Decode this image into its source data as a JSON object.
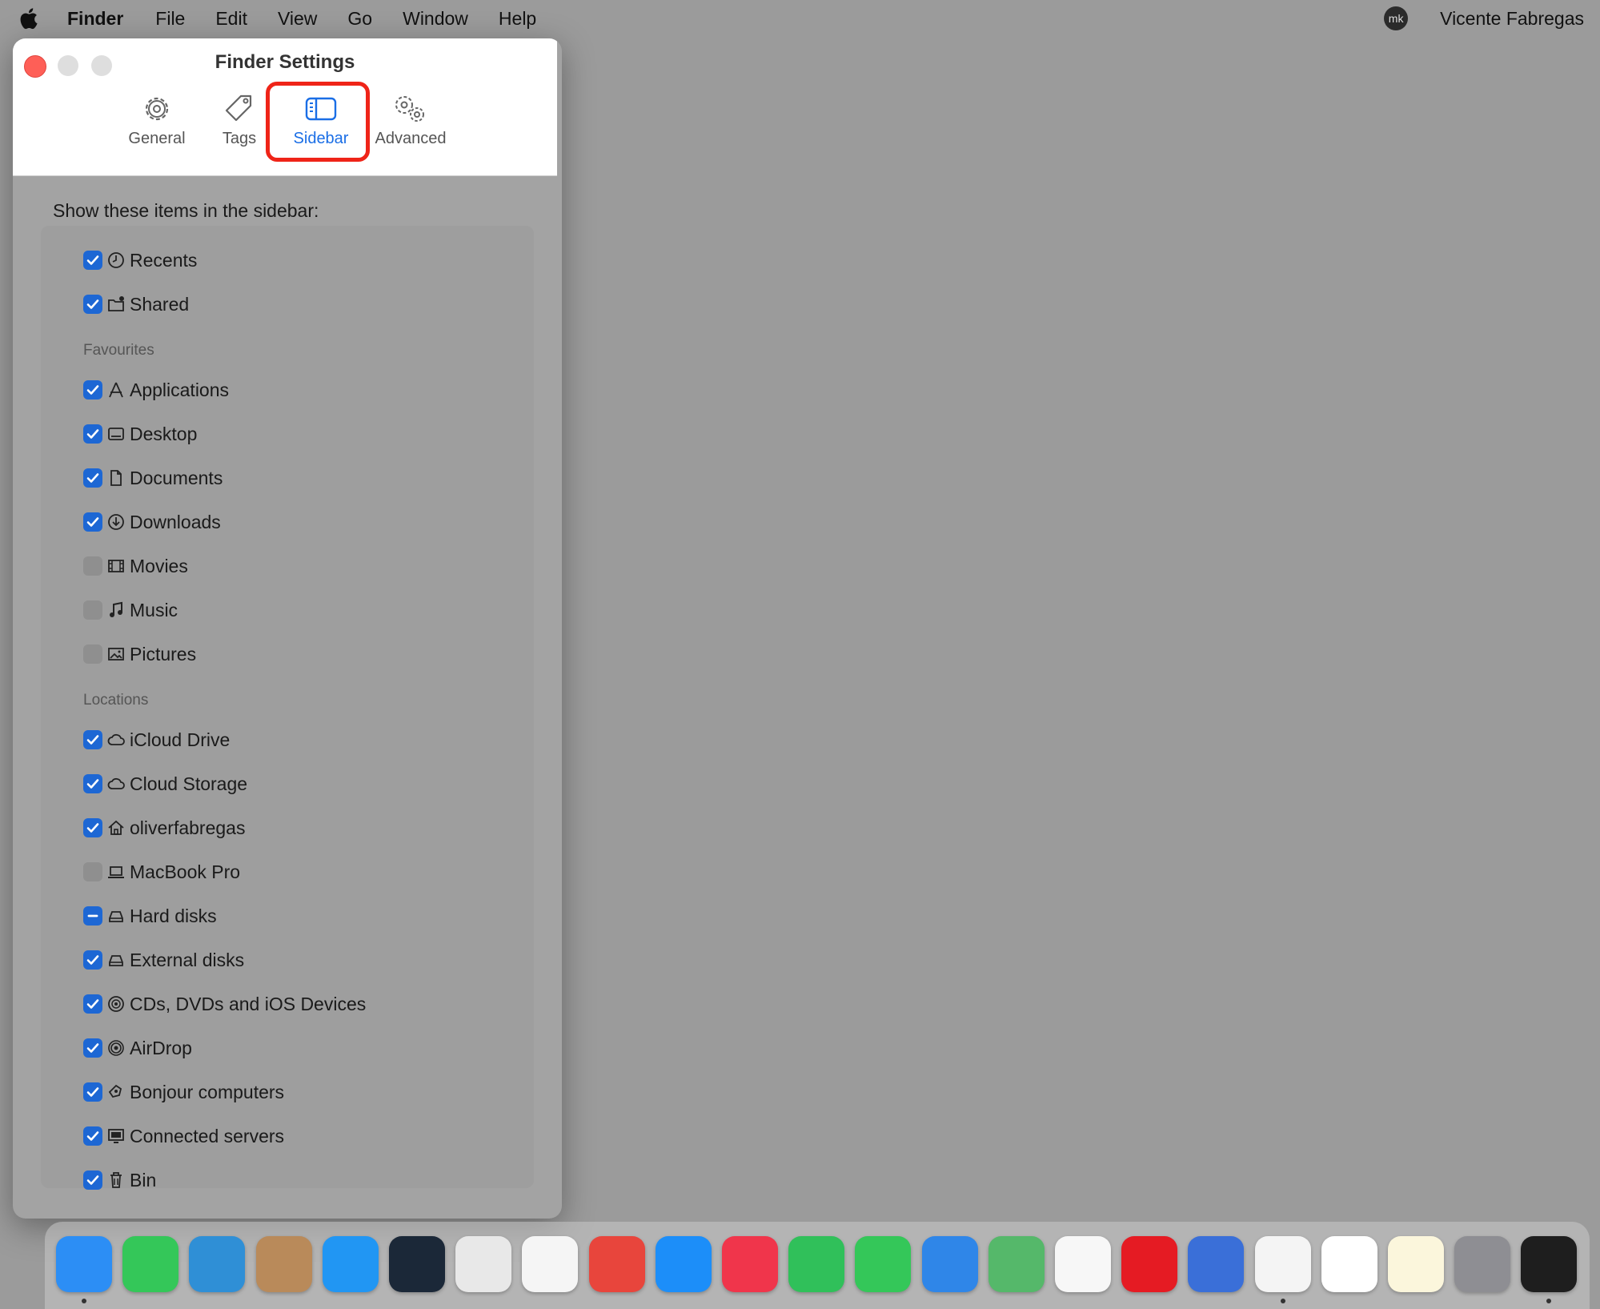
{
  "menubar": {
    "app": "Finder",
    "items": [
      "File",
      "Edit",
      "View",
      "Go",
      "Window",
      "Help"
    ],
    "status_icon": "mk",
    "user": "Vicente Fabregas"
  },
  "window": {
    "title": "Finder Settings",
    "tabs": [
      {
        "label": "General",
        "icon": "gear-icon"
      },
      {
        "label": "Tags",
        "icon": "tag-icon"
      },
      {
        "label": "Sidebar",
        "icon": "sidebar-icon",
        "active": true
      },
      {
        "label": "Advanced",
        "icon": "gears-icon"
      }
    ],
    "heading": "Show these items in the sidebar:",
    "top_items": [
      {
        "label": "Recents",
        "checked": "on",
        "icon": "clock-icon"
      },
      {
        "label": "Shared",
        "checked": "on",
        "icon": "shared-folder-icon"
      }
    ],
    "favourites_label": "Favourites",
    "favourites": [
      {
        "label": "Applications",
        "checked": "on",
        "icon": "applications-icon"
      },
      {
        "label": "Desktop",
        "checked": "on",
        "icon": "desktop-icon"
      },
      {
        "label": "Documents",
        "checked": "on",
        "icon": "document-icon"
      },
      {
        "label": "Downloads",
        "checked": "on",
        "icon": "download-icon"
      },
      {
        "label": "Movies",
        "checked": "off",
        "icon": "film-icon"
      },
      {
        "label": "Music",
        "checked": "off",
        "icon": "music-note-icon"
      },
      {
        "label": "Pictures",
        "checked": "off",
        "icon": "photo-icon"
      }
    ],
    "locations_label": "Locations",
    "locations": [
      {
        "label": "iCloud Drive",
        "checked": "on",
        "icon": "cloud-icon"
      },
      {
        "label": "Cloud Storage",
        "checked": "on",
        "icon": "cloud-icon"
      },
      {
        "label": "oliverfabregas",
        "checked": "on",
        "icon": "home-icon"
      },
      {
        "label": "MacBook Pro",
        "checked": "off",
        "icon": "laptop-icon"
      },
      {
        "label": "Hard disks",
        "checked": "mixed",
        "icon": "hard-disk-icon"
      },
      {
        "label": "External disks",
        "checked": "on",
        "icon": "external-disk-icon"
      },
      {
        "label": "CDs, DVDs and iOS Devices",
        "checked": "on",
        "icon": "disc-icon"
      },
      {
        "label": "AirDrop",
        "checked": "on",
        "icon": "airdrop-icon"
      },
      {
        "label": "Bonjour computers",
        "checked": "on",
        "icon": "bonjour-icon"
      },
      {
        "label": "Connected servers",
        "checked": "on",
        "icon": "server-icon"
      },
      {
        "label": "Bin",
        "checked": "on",
        "icon": "trash-icon"
      }
    ]
  },
  "dock": [
    {
      "name": "finder",
      "color": "#2c8ef5",
      "running": true
    },
    {
      "name": "facetime",
      "color": "#34c759",
      "running": false
    },
    {
      "name": "mk",
      "color": "#2f8fd6",
      "running": false
    },
    {
      "name": "contacts",
      "color": "#b98a5a",
      "running": false
    },
    {
      "name": "safari",
      "color": "#2196f3",
      "running": false
    },
    {
      "name": "steam",
      "color": "#1b2838",
      "running": false
    },
    {
      "name": "launchpad",
      "color": "#e8e8e8",
      "running": false
    },
    {
      "name": "reminders",
      "color": "#f5f5f5",
      "running": false
    },
    {
      "name": "rocket",
      "color": "#e8453c",
      "running": false
    },
    {
      "name": "app-store",
      "color": "#1c8ef9",
      "running": false
    },
    {
      "name": "music",
      "color": "#f0354b",
      "running": false
    },
    {
      "name": "phone",
      "color": "#30c05a",
      "running": false
    },
    {
      "name": "messages",
      "color": "#34c759",
      "running": false
    },
    {
      "name": "mail",
      "color": "#2f86e8",
      "running": false
    },
    {
      "name": "maps",
      "color": "#55b86a",
      "running": false
    },
    {
      "name": "photos",
      "color": "#f7f7f7",
      "running": false
    },
    {
      "name": "opera",
      "color": "#e51b23",
      "running": false
    },
    {
      "name": "simulator",
      "color": "#3a6fd8",
      "running": false
    },
    {
      "name": "chrome",
      "color": "#f4f4f4",
      "running": true
    },
    {
      "name": "slack",
      "color": "#ffffff",
      "running": false
    },
    {
      "name": "notes",
      "color": "#fbf6dc",
      "running": false
    },
    {
      "name": "system-settings",
      "color": "#8e8e93",
      "running": false
    },
    {
      "name": "terminal",
      "color": "#1e1e1e",
      "running": true
    }
  ]
}
